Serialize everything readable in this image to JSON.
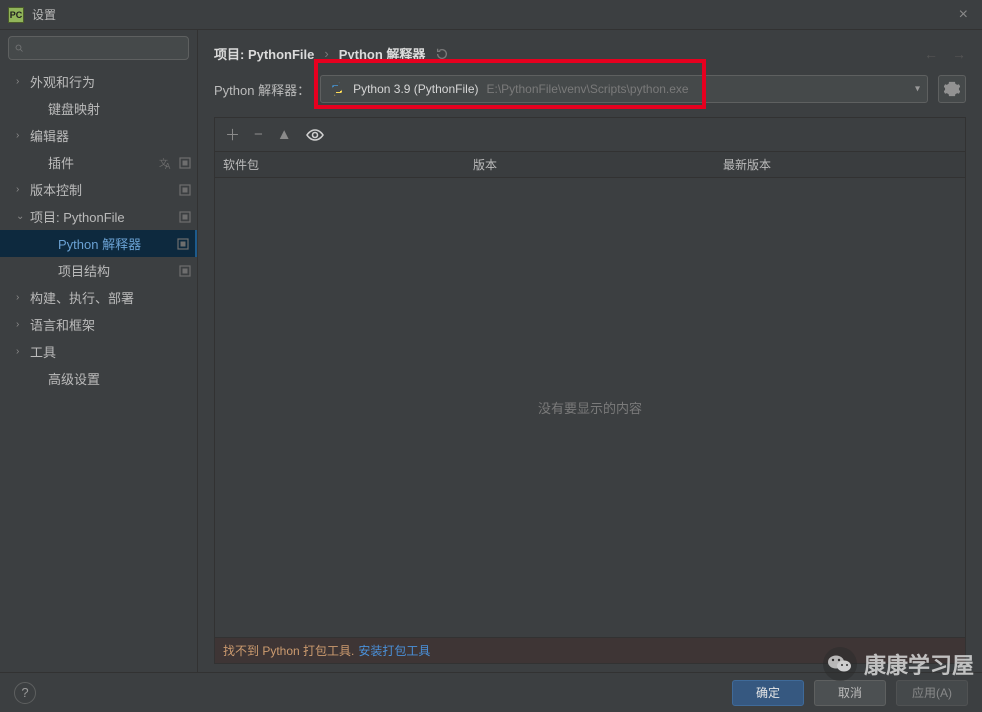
{
  "window": {
    "title": "设置",
    "close_glyph": "×",
    "app_icon_label": "PC"
  },
  "search": {
    "placeholder": ""
  },
  "sidebar": {
    "items": [
      {
        "label": "外观和行为",
        "arrow": "›",
        "indent": 0,
        "selected": false,
        "icons": []
      },
      {
        "label": "键盘映射",
        "arrow": "",
        "indent": 1,
        "selected": false,
        "icons": []
      },
      {
        "label": "编辑器",
        "arrow": "›",
        "indent": 0,
        "selected": false,
        "icons": []
      },
      {
        "label": "插件",
        "arrow": "",
        "indent": 1,
        "selected": false,
        "icons": [
          "translate",
          "sq"
        ]
      },
      {
        "label": "版本控制",
        "arrow": "›",
        "indent": 0,
        "selected": false,
        "icons": [
          "sq"
        ]
      },
      {
        "label": "项目: PythonFile",
        "arrow": "⌄",
        "indent": 0,
        "selected": false,
        "icons": [
          "sq"
        ]
      },
      {
        "label": "Python 解释器",
        "arrow": "",
        "indent": 2,
        "selected": true,
        "icons": [
          "sq"
        ]
      },
      {
        "label": "项目结构",
        "arrow": "",
        "indent": 2,
        "selected": false,
        "icons": [
          "sq"
        ]
      },
      {
        "label": "构建、执行、部署",
        "arrow": "›",
        "indent": 0,
        "selected": false,
        "icons": []
      },
      {
        "label": "语言和框架",
        "arrow": "›",
        "indent": 0,
        "selected": false,
        "icons": []
      },
      {
        "label": "工具",
        "arrow": "›",
        "indent": 0,
        "selected": false,
        "icons": []
      },
      {
        "label": "高级设置",
        "arrow": "",
        "indent": 1,
        "selected": false,
        "icons": []
      }
    ]
  },
  "breadcrumb": {
    "items": [
      "项目: PythonFile",
      "Python 解释器"
    ],
    "sep": "›"
  },
  "interpreter": {
    "label": "Python 解释器：",
    "name": "Python 3.9 (PythonFile)",
    "path": "E:\\PythonFile\\venv\\Scripts\\python.exe"
  },
  "packages": {
    "headers": [
      "软件包",
      "版本",
      "最新版本"
    ],
    "empty_text": "没有要显示的内容",
    "footer_text": "找不到 Python 打包工具.",
    "footer_link": "安装打包工具"
  },
  "buttons": {
    "ok": "确定",
    "cancel": "取消",
    "apply": "应用(A)"
  },
  "watermark": {
    "text": "康康学习屋"
  }
}
